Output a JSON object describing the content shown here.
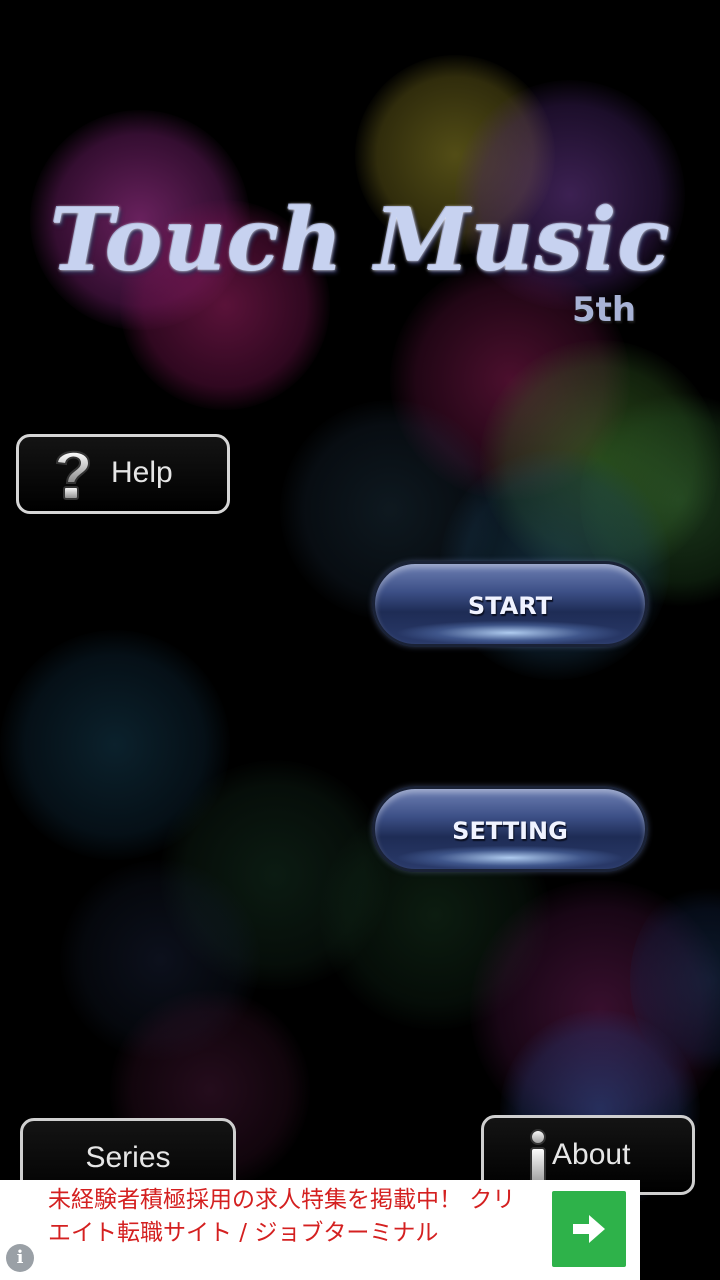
{
  "app": {
    "title": "Touch Music",
    "edition": "5th"
  },
  "menu": {
    "help_label": "Help",
    "start_label": "START",
    "setting_label": "SETTING",
    "series_label": "Series",
    "about_label": "About"
  },
  "ad": {
    "text": "未経験者積極採用の求人特集を掲載中！ クリエイト転職サイト / ジョブターミナル",
    "info_glyph": "i",
    "arrow_icon": "right-arrow-icon",
    "accent_color": "#2eb24a",
    "text_color": "#d42020"
  },
  "icons": {
    "help": "question-mark-icon",
    "about": "info-icon"
  }
}
